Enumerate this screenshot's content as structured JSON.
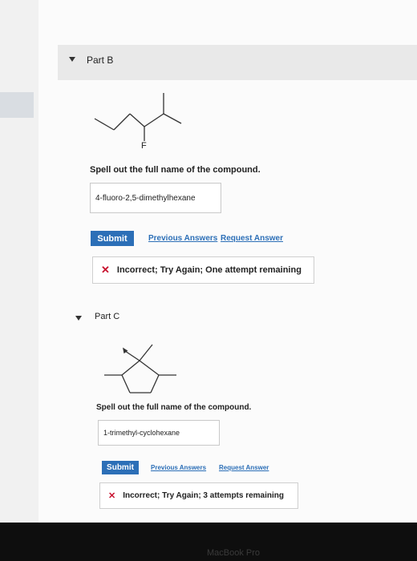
{
  "part_b": {
    "title": "Part B",
    "fluorine_label": "F",
    "prompt": "Spell out the full name of the compound.",
    "answer_value": "4-fluoro-2,5-dimethylhexane",
    "submit_label": "Submit",
    "previous_answers_label": "Previous Answers",
    "request_answer_label": "Request Answer",
    "feedback_icon": "x-mark-icon",
    "feedback_text": "Incorrect; Try Again; One attempt remaining"
  },
  "part_c": {
    "title": "Part C",
    "prompt": "Spell out the full name of the compound.",
    "answer_value": "1-trimethyl-cyclohexane",
    "submit_label": "Submit",
    "previous_answers_label": "Previous Answers",
    "request_answer_label": "Request Answer",
    "feedback_icon": "x-mark-icon",
    "feedback_text": "Incorrect; Try Again; 3 attempts remaining"
  },
  "footer": {
    "brand": "MacBook Pro"
  },
  "colors": {
    "accent": "#2c6fb7",
    "error": "#c8102e"
  }
}
